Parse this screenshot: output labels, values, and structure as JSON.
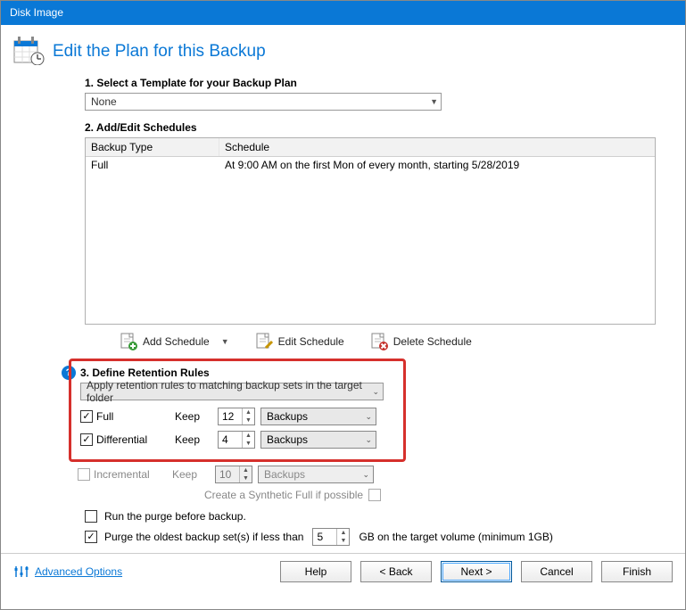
{
  "titlebar": "Disk Image",
  "headerTitle": "Edit the Plan for this Backup",
  "section1": {
    "label": "1. Select a Template for your Backup Plan",
    "templateValue": "None"
  },
  "section2": {
    "label": "2. Add/Edit Schedules",
    "colType": "Backup Type",
    "colSchedule": "Schedule",
    "rows": [
      {
        "type": "Full",
        "schedule": "At 9:00 AM on the first Mon of every month, starting 5/28/2019"
      }
    ],
    "addSchedule": "Add Schedule",
    "editSchedule": "Edit Schedule",
    "deleteSchedule": "Delete Schedule"
  },
  "section3": {
    "label": "3. Define Retention Rules",
    "scopeValue": "Apply retention rules to matching backup sets in the target folder",
    "rows": [
      {
        "name": "Full",
        "checked": true,
        "keep": "Keep",
        "value": "12",
        "unit": "Backups",
        "disabled": false
      },
      {
        "name": "Differential",
        "checked": true,
        "keep": "Keep",
        "value": "4",
        "unit": "Backups",
        "disabled": false
      },
      {
        "name": "Incremental",
        "checked": false,
        "keep": "Keep",
        "value": "10",
        "unit": "Backups",
        "disabled": true
      }
    ],
    "synthLabel": "Create a Synthetic Full if possible"
  },
  "post": {
    "runBefore": {
      "label": "Run the purge before backup.",
      "checked": false
    },
    "purgeOld": {
      "prefix": "Purge the oldest backup set(s) if less than",
      "value": "5",
      "suffix": "GB on the target volume (minimum 1GB)",
      "checked": true
    }
  },
  "footer": {
    "advanced": "Advanced Options",
    "help": "Help",
    "back": "< Back",
    "next": "Next >",
    "cancel": "Cancel",
    "finish": "Finish"
  }
}
